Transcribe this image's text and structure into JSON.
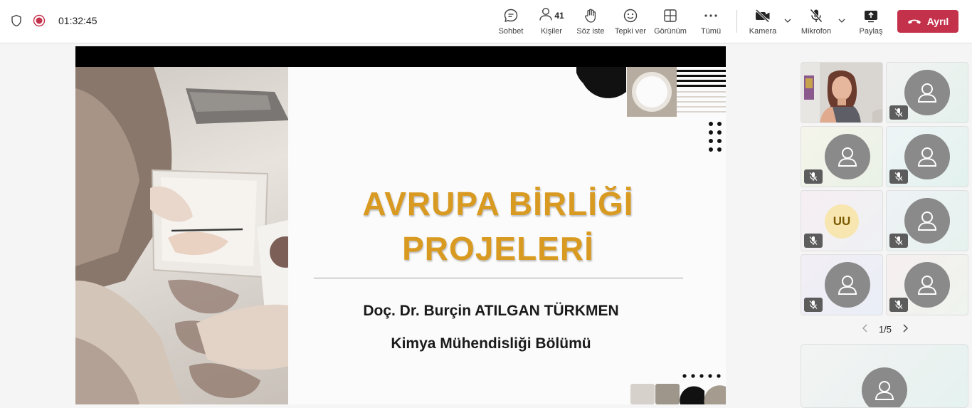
{
  "meeting": {
    "timer": "01:32:45"
  },
  "toolbar": {
    "chat_label": "Sohbet",
    "people_label": "Kişiler",
    "people_count": "41",
    "raise_label": "Söz iste",
    "react_label": "Tepki ver",
    "view_label": "Görünüm",
    "more_label": "Tümü",
    "camera_label": "Kamera",
    "mic_label": "Mikrofon",
    "share_label": "Paylaş",
    "leave_label": "Ayrıl"
  },
  "slide": {
    "title_line1": "AVRUPA BİRLİĞİ",
    "title_line2": "PROJELERİ",
    "presenter": "Doç. Dr. Burçin ATILGAN TÜRKMEN",
    "department": "Kimya Mühendisliği Bölümü"
  },
  "gallery": {
    "initials_tile": "UU",
    "page_indicator": "1/5"
  },
  "colors": {
    "accent_title": "#d99a21",
    "leave_button": "#c4314b"
  }
}
